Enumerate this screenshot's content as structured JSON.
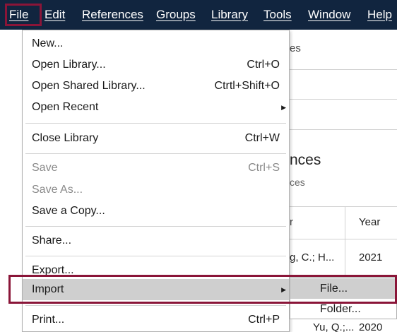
{
  "menubar": {
    "items": [
      "File",
      "Edit",
      "References",
      "Groups",
      "Library",
      "Tools",
      "Window",
      "Help"
    ]
  },
  "background": {
    "frag1": "es",
    "title_frag": "nces",
    "sub_frag": "ces",
    "col_author_frag": "r",
    "col_year": "Year",
    "row1_author": "g, C.; H...",
    "row1_year": "2021",
    "row3_author": "Yu, Q.;...",
    "row3_year": "2020"
  },
  "file_menu": {
    "new": "New...",
    "open_library": "Open Library...",
    "open_library_shortcut": "Ctrl+O",
    "open_shared": "Open Shared Library...",
    "open_shared_shortcut": "Ctrtl+Shift+O",
    "open_recent": "Open Recent",
    "close_library": "Close Library",
    "close_library_shortcut": "Ctrl+W",
    "save": "Save",
    "save_shortcut": "Ctrl+S",
    "save_as": "Save As...",
    "save_copy": "Save a Copy...",
    "share": "Share...",
    "export": "Export...",
    "import": "Import",
    "print": "Print...",
    "print_shortcut": "Ctrl+P"
  },
  "import_submenu": {
    "file": "File...",
    "folder": "Folder..."
  },
  "colors": {
    "menubar_bg": "#11253f",
    "highlight_frame": "#8a1538",
    "selected_row": "#cfcfcf"
  },
  "icons": {
    "submenu_arrow": "chevron-right-icon"
  }
}
